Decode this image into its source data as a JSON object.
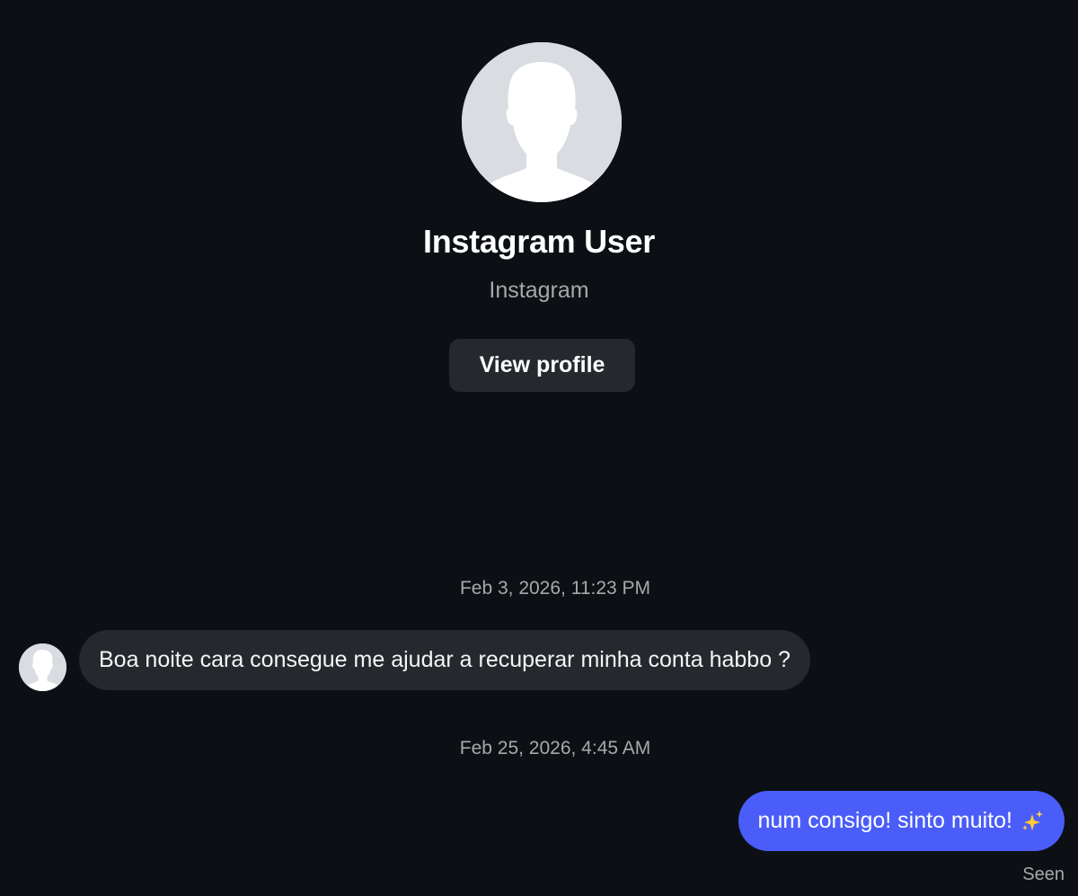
{
  "profile": {
    "name": "Instagram User",
    "subtitle": "Instagram",
    "view_profile_label": "View profile",
    "avatar_icon": "default-user-silhouette-icon"
  },
  "messages": [
    {
      "timestamp": "Feb 3, 2026, 11:23 PM",
      "direction": "incoming",
      "text": "Boa noite cara consegue me ajudar a recuperar minha conta habbo ?"
    },
    {
      "timestamp": "Feb 25, 2026, 4:45 AM",
      "direction": "outgoing",
      "text": "num consigo! sinto muito!",
      "emoji": "sparkles-icon"
    }
  ],
  "status": {
    "seen_label": "Seen"
  },
  "colors": {
    "background": "#0c1014",
    "incoming_bubble": "#25292e",
    "outgoing_bubble": "#4a5df9",
    "muted_text": "#a8a8a8"
  }
}
